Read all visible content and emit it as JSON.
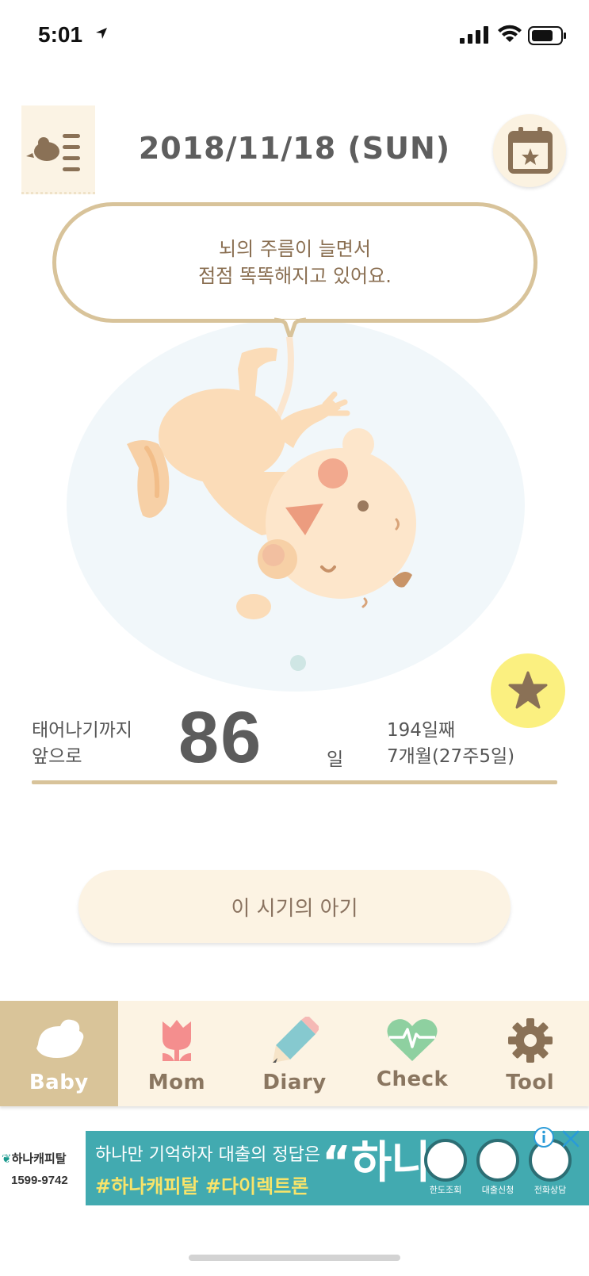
{
  "status_bar": {
    "time": "5:01",
    "icons": [
      "location-arrow-icon",
      "signal-icon",
      "wifi-icon",
      "battery-icon"
    ]
  },
  "header": {
    "date": "2018/11/18 (SUN)",
    "menu_icon": "bird-menu-icon",
    "calendar_icon": "calendar-star-icon"
  },
  "bubble": {
    "line1": "뇌의 주름이 늘면서",
    "line2": "점점 똑똑해지고 있어요."
  },
  "countdown": {
    "label_line1": "태어나기까지",
    "label_line2": "앞으로",
    "days_left": "86",
    "unit": "일",
    "day_count": "194일째",
    "month_week": "7개월(27주5일)"
  },
  "period_button": {
    "label": "이 시기의 아기"
  },
  "tabs": [
    {
      "label": "Baby",
      "icon": "bird-icon",
      "active": true
    },
    {
      "label": "Mom",
      "icon": "tulip-icon",
      "active": false
    },
    {
      "label": "Diary",
      "icon": "pencil-icon",
      "active": false
    },
    {
      "label": "Check",
      "icon": "heartbeat-icon",
      "active": false
    },
    {
      "label": "Tool",
      "icon": "gear-icon",
      "active": false
    }
  ],
  "ad": {
    "brand": "하나캐피탈",
    "phone": "1599-9742",
    "line1": "하나만 기억하자 대출의 정답은",
    "line2": "#하나캐피탈 #다이렉트론",
    "highlight": "“하나”",
    "buttons": [
      "한도조회",
      "대출신청",
      "전화상담"
    ]
  },
  "colors": {
    "accent": "#d9c499",
    "background_cream": "#fcf3e3",
    "star_yellow": "#fbf080",
    "ad_teal": "#42aab0"
  }
}
